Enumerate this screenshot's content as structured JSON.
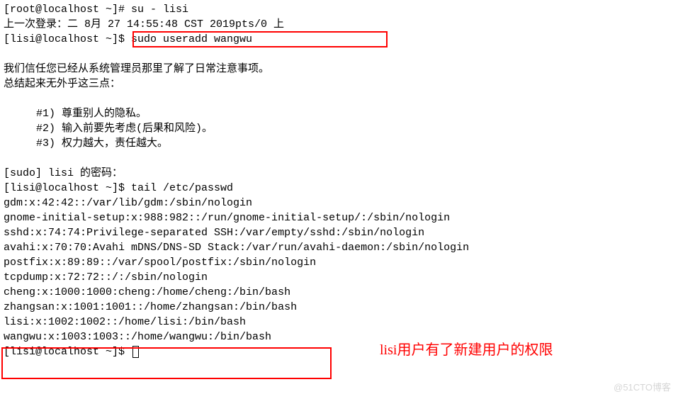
{
  "lines": {
    "l0": "[root@localhost ~]# su - lisi",
    "l1": "上一次登录：二 8月 27 14:55:48 CST 2019pts/0 上",
    "l2": "[lisi@localhost ~]$ sudo useradd wangwu",
    "l3": "我们信任您已经从系统管理员那里了解了日常注意事项。",
    "l4": "总结起来无外乎这三点：",
    "l5": "#1) 尊重别人的隐私。",
    "l6": "#2) 输入前要先考虑(后果和风险)。",
    "l7": "#3) 权力越大，责任越大。",
    "l8": "[sudo] lisi 的密码：",
    "l9": "[lisi@localhost ~]$ tail /etc/passwd",
    "l10": "gdm:x:42:42::/var/lib/gdm:/sbin/nologin",
    "l11": "gnome-initial-setup:x:988:982::/run/gnome-initial-setup/:/sbin/nologin",
    "l12": "sshd:x:74:74:Privilege-separated SSH:/var/empty/sshd:/sbin/nologin",
    "l13": "avahi:x:70:70:Avahi mDNS/DNS-SD Stack:/var/run/avahi-daemon:/sbin/nologin",
    "l14": "postfix:x:89:89::/var/spool/postfix:/sbin/nologin",
    "l15": "tcpdump:x:72:72::/:/sbin/nologin",
    "l16": "cheng:x:1000:1000:cheng:/home/cheng:/bin/bash",
    "l17": "zhangsan:x:1001:1001::/home/zhangsan:/bin/bash",
    "l18": "lisi:x:1002:1002::/home/lisi:/bin/bash",
    "l19": "wangwu:x:1003:1003::/home/wangwu:/bin/bash",
    "l20": "[lisi@localhost ~]$ "
  },
  "annotation": "lisi用户有了新建用户的权限",
  "watermark": "@51CTO博客"
}
